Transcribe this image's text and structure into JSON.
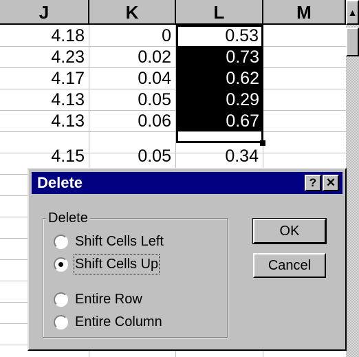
{
  "spreadsheet": {
    "columns": [
      "J",
      "K",
      "L",
      "M"
    ],
    "rows": [
      {
        "J": "4.18",
        "K": "0",
        "L": "0.53"
      },
      {
        "J": "4.23",
        "K": "0.02",
        "L": "0.73"
      },
      {
        "J": "4.17",
        "K": "0.04",
        "L": "0.62"
      },
      {
        "J": "4.13",
        "K": "0.05",
        "L": "0.29"
      },
      {
        "J": "4.13",
        "K": "0.06",
        "L": "0.67"
      },
      {
        "J": "4.15",
        "K": "0.05",
        "L": "0.34"
      }
    ]
  },
  "scrollbar": {
    "up_arrow": "▲"
  },
  "dialog": {
    "title": "Delete",
    "help_button": "?",
    "close_button": "✕",
    "group_label": "Delete",
    "options": [
      {
        "label": "Shift Cells Left",
        "checked": false
      },
      {
        "label": "Shift Cells Up",
        "checked": true
      },
      {
        "label": "Entire Row",
        "checked": false
      },
      {
        "label": "Entire Column",
        "checked": false
      }
    ],
    "ok_label": "OK",
    "cancel_label": "Cancel"
  },
  "colors": {
    "title_bar": "#000080",
    "face": "#c0c0c0",
    "selection": "#000000"
  }
}
